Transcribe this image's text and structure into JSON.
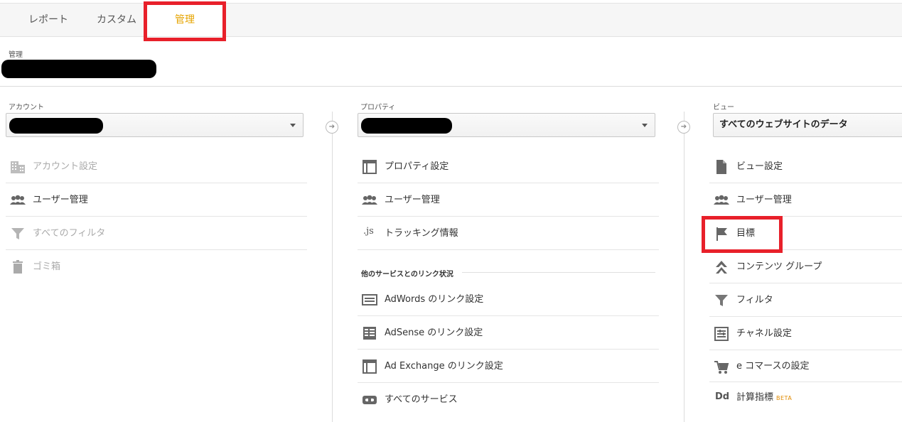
{
  "tabs": [
    {
      "label": "レポート"
    },
    {
      "label": "カスタム"
    },
    {
      "label": "管理"
    }
  ],
  "breadcrumb": {
    "label": "管理"
  },
  "account": {
    "label": "アカウント",
    "items": [
      {
        "label": "アカウント設定",
        "icon": "building-icon"
      },
      {
        "label": "ユーザー管理",
        "icon": "users-icon"
      },
      {
        "label": "すべてのフィルタ",
        "icon": "filter-icon"
      },
      {
        "label": "ゴミ箱",
        "icon": "trash-icon"
      }
    ]
  },
  "property": {
    "label": "プロパティ",
    "items": [
      {
        "label": "プロパティ設定",
        "icon": "window-icon"
      },
      {
        "label": "ユーザー管理",
        "icon": "users-icon"
      },
      {
        "label": "トラッキング情報",
        "icon": "js-icon",
        "glyph": ".js"
      }
    ],
    "section_title": "他のサービスとのリンク状況",
    "link_items": [
      {
        "label": "AdWords のリンク設定",
        "icon": "adwords-icon"
      },
      {
        "label": "AdSense のリンク設定",
        "icon": "adsense-icon"
      },
      {
        "label": "Ad Exchange のリンク設定",
        "icon": "window-icon"
      },
      {
        "label": "すべてのサービス",
        "icon": "link-icon"
      }
    ]
  },
  "view": {
    "label": "ビュー",
    "selected": "すべてのウェブサイトのデータ",
    "items": [
      {
        "label": "ビュー設定",
        "icon": "document-icon"
      },
      {
        "label": "ユーザー管理",
        "icon": "users-icon"
      },
      {
        "label": "目標",
        "icon": "flag-icon"
      },
      {
        "label": "コンテンツ グループ",
        "icon": "content-group-icon"
      },
      {
        "label": "フィルタ",
        "icon": "filter-icon"
      },
      {
        "label": "チャネル設定",
        "icon": "channel-icon"
      },
      {
        "label": "e コマースの設定",
        "icon": "cart-icon"
      },
      {
        "label": "計算指標",
        "icon": "dd-icon",
        "glyph": "Dd",
        "badge": "BETA"
      }
    ]
  }
}
